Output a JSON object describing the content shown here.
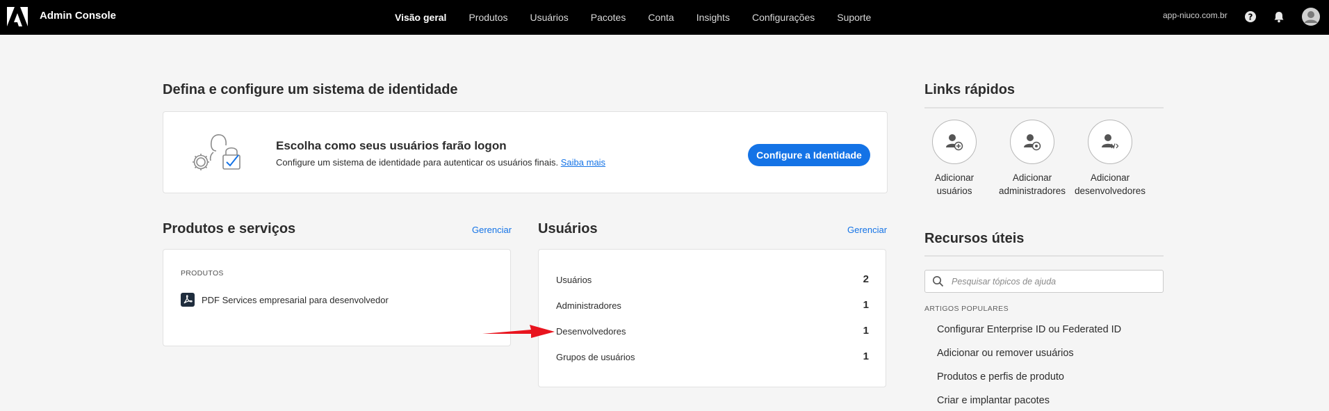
{
  "header": {
    "app_title": "Admin Console",
    "nav": [
      {
        "label": "Visão geral",
        "active": true
      },
      {
        "label": "Produtos"
      },
      {
        "label": "Usuários"
      },
      {
        "label": "Pacotes"
      },
      {
        "label": "Conta"
      },
      {
        "label": "Insights"
      },
      {
        "label": "Configurações"
      },
      {
        "label": "Suporte"
      }
    ],
    "org_name": "app-niuco.com.br"
  },
  "identity": {
    "title": "Defina e configure um sistema de identidade",
    "heading": "Escolha como seus usuários farão logon",
    "text": "Configure um sistema de identidade para autenticar os usuários finais.",
    "learn_more": "Saiba mais",
    "button": "Configure a Identidade"
  },
  "products": {
    "title": "Produtos e serviços",
    "manage": "Gerenciar",
    "section_label": "PRODUTOS",
    "items": [
      {
        "name": "PDF Services empresarial para desenvolvedor"
      }
    ]
  },
  "users": {
    "title": "Usuários",
    "manage": "Gerenciar",
    "rows": [
      {
        "label": "Usuários",
        "count": "2"
      },
      {
        "label": "Administradores",
        "count": "1"
      },
      {
        "label": "Desenvolvedores",
        "count": "1"
      },
      {
        "label": "Grupos de usuários",
        "count": "1"
      }
    ]
  },
  "quick_links": {
    "title": "Links rápidos",
    "items": [
      {
        "line1": "Adicionar",
        "line2": "usuários"
      },
      {
        "line1": "Adicionar",
        "line2": "administradores"
      },
      {
        "line1": "Adicionar",
        "line2": "desenvolvedores"
      }
    ]
  },
  "resources": {
    "title": "Recursos úteis",
    "search_placeholder": "Pesquisar tópicos de ajuda",
    "popular_label": "ARTIGOS POPULARES",
    "articles": [
      "Configurar Enterprise ID ou Federated ID",
      "Adicionar ou remover usuários",
      "Produtos e perfis de produto",
      "Criar e implantar pacotes"
    ]
  },
  "colors": {
    "accent": "#1473e6",
    "topbar": "#000000",
    "annotation_arrow": "#e8141e"
  }
}
